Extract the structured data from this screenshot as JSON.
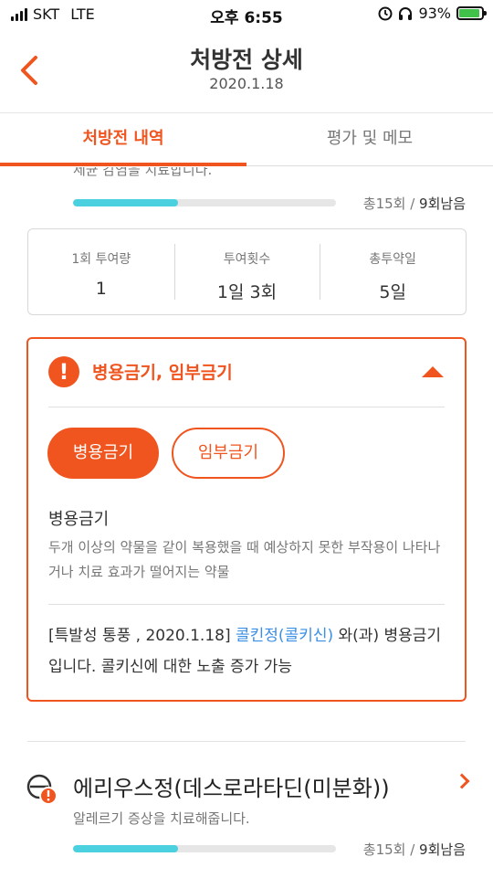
{
  "status_bar": {
    "carrier": "SKT",
    "network": "LTE",
    "time": "오후 6:55",
    "battery": "93%",
    "battery_level": 0.93,
    "battery_color": "#3fc14a"
  },
  "header": {
    "title": "처방전 상세",
    "date": "2020.1.18"
  },
  "tabs": [
    {
      "label": "처방전 내역",
      "active": true
    },
    {
      "label": "평가 및 메모",
      "active": false
    }
  ],
  "drug1": {
    "description": "세균 감염을 치료합니다.",
    "total": "총15회",
    "slash": " / ",
    "remaining": "9회남음",
    "progress": 0.4
  },
  "dosage": {
    "columns": [
      {
        "label": "1회 투여량",
        "value": "1"
      },
      {
        "label": "투여횟수",
        "value": "1일 3회"
      },
      {
        "label": "총투약일",
        "value": "5일"
      }
    ]
  },
  "warning": {
    "icon": "!",
    "title": "병용금기, 임부금기",
    "chips": [
      {
        "label": "병용금기",
        "selected": true
      },
      {
        "label": "임부금기",
        "selected": false
      }
    ],
    "definition_title": "병용금기",
    "definition_text": "두개 이상의 약물을 같이 복용했을 때 예상하지 못한 부작용이 나타나거나 치료 효과가 떨어지는 약물",
    "detail_prefix": "[특발성 통풍 , 2020.1.18] ",
    "detail_drug": "콜킨정(콜키신)",
    "detail_suffix": " 와(과) 병용금기입니다. 콜키신에 대한 노출 증가 가능"
  },
  "drug2": {
    "name": "에리우스정(데스로라타딘(미분화))",
    "description": "알레르기 증상을 치료해줍니다.",
    "total": "총15회",
    "slash": " / ",
    "remaining": "9회남음",
    "progress": 0.4
  },
  "colors": {
    "accent": "#f0551f",
    "progress": "#4bd0e0",
    "link": "#3a8ee6"
  },
  "icons": [
    "back-arrow-icon",
    "alarm-icon",
    "headphones-icon",
    "battery-icon",
    "warning-icon",
    "collapse-arrow-icon",
    "pill-warning-icon",
    "chevron-right-icon"
  ]
}
